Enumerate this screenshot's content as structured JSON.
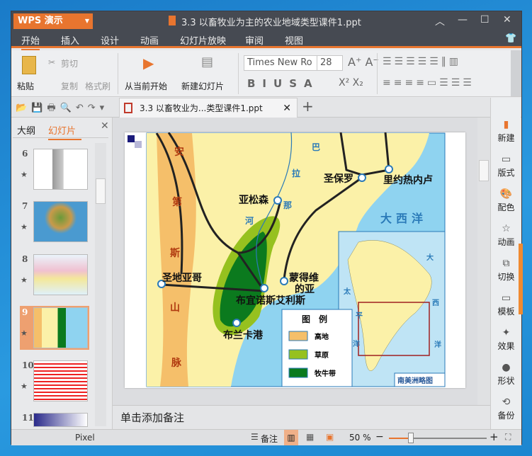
{
  "app": {
    "name": "WPS 演示",
    "file_title": "3.3   以畜牧业为主的农业地域类型课件1.ppt"
  },
  "menu": [
    "开始",
    "插入",
    "设计",
    "动画",
    "幻灯片放映",
    "审阅",
    "视图"
  ],
  "ribbon": {
    "paste": "粘贴",
    "cut": "剪切",
    "copy": "复制",
    "format_painter": "格式刷",
    "from_current": "从当前开始",
    "new_slide": "新建幻灯片",
    "font": "Times New Ro",
    "size": "28"
  },
  "doc_tab": "3.3   以畜牧业为...类型课件1.ppt",
  "panel": {
    "tabs": [
      "大纲",
      "幻灯片"
    ],
    "slides": [
      "6",
      "7",
      "8",
      "9",
      "10",
      "11"
    ],
    "active": "9"
  },
  "map": {
    "mountain": [
      "安",
      "第",
      "斯",
      "山",
      "脉"
    ],
    "river": [
      "巴",
      "拉",
      "那",
      "河"
    ],
    "cities": {
      "asuncion": "亚松森",
      "saopaulo": "圣保罗",
      "rio": "里约热内卢",
      "santiago": "圣地亚哥",
      "buenosaires": "布宜诺斯艾利斯",
      "montevideo1": "蒙得维",
      "montevideo2": "的亚",
      "bahiablanca": "布兰卡港"
    },
    "ocean": "大西洋",
    "inset": {
      "atl": [
        "大",
        "西",
        "洋"
      ],
      "pac": [
        "太",
        "平",
        "洋"
      ],
      "title": "南美洲略图"
    },
    "legend": {
      "title": "图　例",
      "items": [
        "高地",
        "草原",
        "牧牛带"
      ]
    },
    "colors": {
      "highland": "#f5bf6a",
      "grassland": "#96c11f",
      "cattle": "#0b7a1e",
      "land": "#fbf1a8",
      "sea": "#8fd3f0"
    }
  },
  "notes": "单击添加备注",
  "sidebar": [
    "新建",
    "版式",
    "配色",
    "动画",
    "切换",
    "模板",
    "效果",
    "形状",
    "备份"
  ],
  "status": {
    "mode": "Pixel",
    "notes": "备注",
    "zoom": "50 %",
    "zoom_value": 50
  }
}
